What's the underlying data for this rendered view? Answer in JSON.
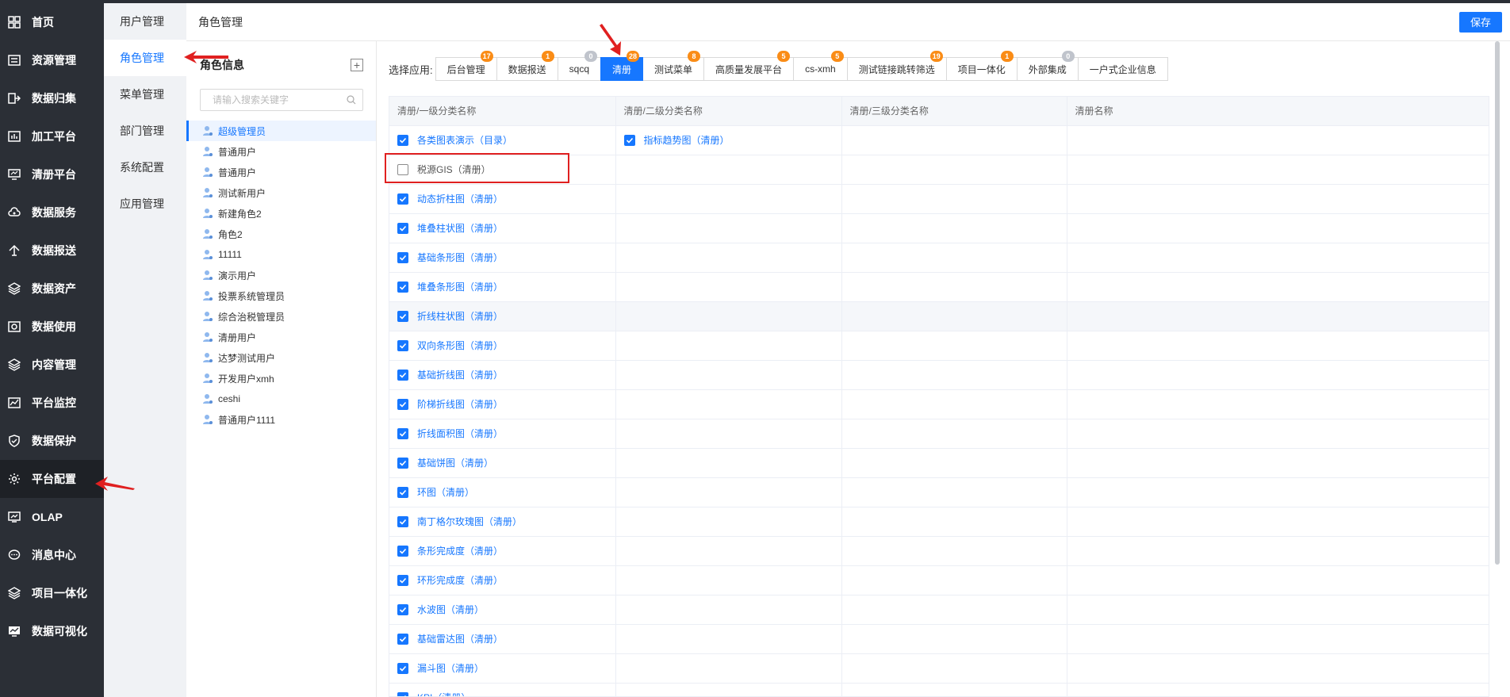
{
  "nav": [
    {
      "label": "首页",
      "icon": "grid-icon"
    },
    {
      "label": "资源管理",
      "icon": "list-icon"
    },
    {
      "label": "数据归集",
      "icon": "collect-icon"
    },
    {
      "label": "加工平台",
      "icon": "bar-icon"
    },
    {
      "label": "清册平台",
      "icon": "monitor-icon"
    },
    {
      "label": "数据服务",
      "icon": "cloud-icon"
    },
    {
      "label": "数据报送",
      "icon": "upload-icon"
    },
    {
      "label": "数据资产",
      "icon": "layers-icon"
    },
    {
      "label": "数据使用",
      "icon": "dashboard-icon"
    },
    {
      "label": "内容管理",
      "icon": "layers-icon"
    },
    {
      "label": "平台监控",
      "icon": "chart-icon"
    },
    {
      "label": "数据保护",
      "icon": "shield-icon"
    },
    {
      "label": "平台配置",
      "icon": "gear-icon"
    },
    {
      "label": "OLAP",
      "icon": "olap-icon"
    },
    {
      "label": "消息中心",
      "icon": "message-icon"
    },
    {
      "label": "项目一体化",
      "icon": "layers-icon"
    },
    {
      "label": "数据可视化",
      "icon": "screen-icon"
    }
  ],
  "submenu": [
    "用户管理",
    "角色管理",
    "菜单管理",
    "部门管理",
    "系统配置",
    "应用管理"
  ],
  "header": {
    "title": "角色管理",
    "save_label": "保存"
  },
  "roles": {
    "title": "角色信息",
    "search_placeholder": "请输入搜索关键字",
    "items": [
      "超级管理员",
      "普通用户",
      "普通用户",
      "测试新用户",
      "新建角色2",
      "角色2",
      "11111",
      "演示用户",
      "投票系统管理员",
      "综合治税管理员",
      "清册用户",
      "达梦测试用户",
      "开发用户xmh",
      "ceshi",
      "普通用户1111"
    ]
  },
  "apps": {
    "label": "选择应用:",
    "tabs": [
      {
        "label": "后台管理",
        "badge": "17"
      },
      {
        "label": "数据报送",
        "badge": "1"
      },
      {
        "label": "sqcq",
        "badge": "0"
      },
      {
        "label": "清册",
        "badge": "28"
      },
      {
        "label": "测试菜单",
        "badge": "8"
      },
      {
        "label": "高质量发展平台",
        "badge": "5"
      },
      {
        "label": "cs-xmh",
        "badge": "5"
      },
      {
        "label": "测试链接跳转筛选",
        "badge": "19"
      },
      {
        "label": "项目一体化",
        "badge": "1"
      },
      {
        "label": "外部集成",
        "badge": "0"
      },
      {
        "label": "一户式企业信息",
        "badge": ""
      }
    ]
  },
  "table": {
    "headers": [
      "清册/一级分类名称",
      "清册/二级分类名称",
      "清册/三级分类名称",
      "清册名称"
    ],
    "rows": [
      {
        "c1": "各类图表演示（目录）",
        "c1_checked": true,
        "c2": "指标趋势图（清册）",
        "c2_checked": true
      },
      {
        "c1": "税源GIS（清册）",
        "c1_checked": false,
        "c2": "",
        "c2_checked": false
      },
      {
        "c1": "动态折柱图（清册）",
        "c1_checked": true,
        "c2": "",
        "c2_checked": false
      },
      {
        "c1": "堆叠柱状图（清册）",
        "c1_checked": true,
        "c2": "",
        "c2_checked": false
      },
      {
        "c1": "基础条形图（清册）",
        "c1_checked": true,
        "c2": "",
        "c2_checked": false
      },
      {
        "c1": "堆叠条形图（清册）",
        "c1_checked": true,
        "c2": "",
        "c2_checked": false
      },
      {
        "c1": "折线柱状图（清册）",
        "c1_checked": true,
        "c2": "",
        "c2_checked": false
      },
      {
        "c1": "双向条形图（清册）",
        "c1_checked": true,
        "c2": "",
        "c2_checked": false
      },
      {
        "c1": "基础折线图（清册）",
        "c1_checked": true,
        "c2": "",
        "c2_checked": false
      },
      {
        "c1": "阶梯折线图（清册）",
        "c1_checked": true,
        "c2": "",
        "c2_checked": false
      },
      {
        "c1": "折线面积图（清册）",
        "c1_checked": true,
        "c2": "",
        "c2_checked": false
      },
      {
        "c1": "基础饼图（清册）",
        "c1_checked": true,
        "c2": "",
        "c2_checked": false
      },
      {
        "c1": "环图（清册）",
        "c1_checked": true,
        "c2": "",
        "c2_checked": false
      },
      {
        "c1": "南丁格尔玫瑰图（清册）",
        "c1_checked": true,
        "c2": "",
        "c2_checked": false
      },
      {
        "c1": "条形完成度（清册）",
        "c1_checked": true,
        "c2": "",
        "c2_checked": false
      },
      {
        "c1": "环形完成度（清册）",
        "c1_checked": true,
        "c2": "",
        "c2_checked": false
      },
      {
        "c1": "水波图（清册）",
        "c1_checked": true,
        "c2": "",
        "c2_checked": false
      },
      {
        "c1": "基础雷达图（清册）",
        "c1_checked": true,
        "c2": "",
        "c2_checked": false
      },
      {
        "c1": "漏斗图（清册）",
        "c1_checked": true,
        "c2": "",
        "c2_checked": false
      },
      {
        "c1": "KPI（清册）",
        "c1_checked": true,
        "c2": "",
        "c2_checked": false
      }
    ]
  },
  "colors": {
    "accent": "#1677ff",
    "nav_bg": "#2b2f36",
    "badge": "#fa8c16",
    "annotation": "#e02020"
  }
}
